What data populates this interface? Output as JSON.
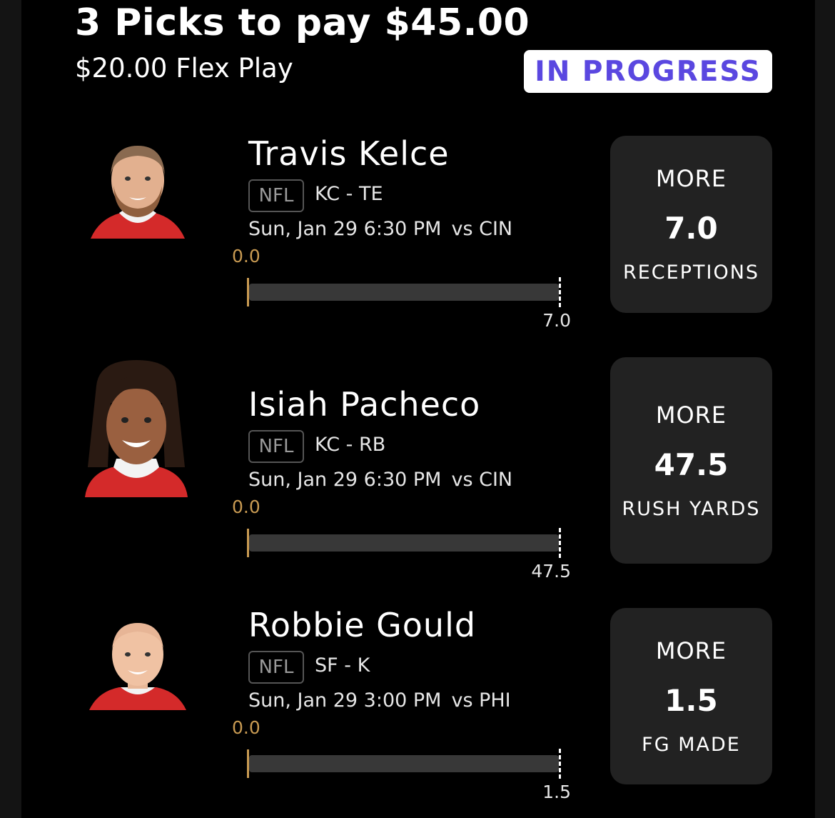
{
  "header": {
    "title": "3 Picks to pay $45.00",
    "subtitle": "$20.00 Flex Play",
    "status": "IN PROGRESS"
  },
  "picks": [
    {
      "player": "Travis Kelce",
      "league": "NFL",
      "team_pos": "KC - TE",
      "game_time": "Sun, Jan 29 6:30 PM",
      "opponent": "vs CIN",
      "current": "0.0",
      "line_label": "7.0",
      "progress": 0,
      "direction": "MORE",
      "line": "7.0",
      "stat": "RECEPTIONS"
    },
    {
      "player": "Isiah Pacheco",
      "league": "NFL",
      "team_pos": "KC - RB",
      "game_time": "Sun, Jan 29 6:30 PM",
      "opponent": "vs CIN",
      "current": "0.0",
      "line_label": "47.5",
      "progress": 0,
      "direction": "MORE",
      "line": "47.5",
      "stat": "RUSH YARDS"
    },
    {
      "player": "Robbie Gould",
      "league": "NFL",
      "team_pos": "SF - K",
      "game_time": "Sun, Jan 29 3:00 PM",
      "opponent": "vs PHI",
      "current": "0.0",
      "line_label": "1.5",
      "progress": 0,
      "direction": "MORE",
      "line": "1.5",
      "stat": "FG MADE"
    }
  ],
  "colors": {
    "accent": "#5a47e0",
    "progress": "#c89a52",
    "card": "#222222"
  }
}
